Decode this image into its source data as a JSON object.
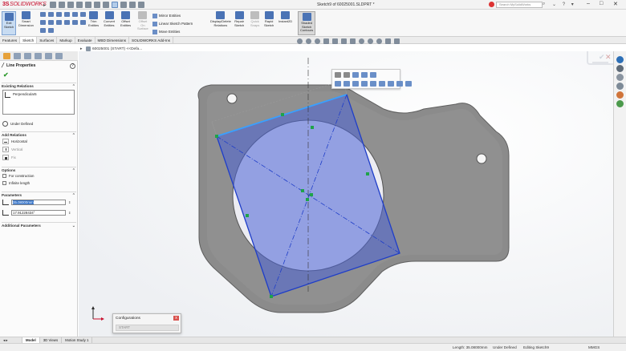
{
  "app": {
    "logo_ds": "3S",
    "logo_text": "SOLIDWORKS",
    "document_title": "Sketch9 of 60025001.SLDPRT *",
    "search_placeholder": "Search MySolidWorks",
    "minimize": "–",
    "restore": "□",
    "close": "✕"
  },
  "ribbon": {
    "exit_sketch": [
      "Exit",
      "Sketch"
    ],
    "smart_dimension": [
      "Smart",
      "Dimension"
    ],
    "trim_entities": [
      "Trim",
      "Entities"
    ],
    "convert_entities": [
      "Convert",
      "Entities"
    ],
    "offset_entities": [
      "Offset",
      "Entities"
    ],
    "offset_on_surface": [
      "Offset",
      "On",
      "Surface"
    ],
    "mirror_entities": "Mirror Entities",
    "linear_sketch_pattern": "Linear Sketch Pattern",
    "move_entities": "Move Entities",
    "display_delete_relations": [
      "Display/Delete",
      "Relations"
    ],
    "repair_sketch": [
      "Repair",
      "Sketch"
    ],
    "quick_snaps": [
      "Quick",
      "Snaps"
    ],
    "rapid_sketch": [
      "Rapid",
      "Sketch"
    ],
    "instant2d": "Instant2D",
    "shaded_sketch_contours": [
      "Shaded",
      "Sketch",
      "Contours"
    ]
  },
  "tabs": [
    "Features",
    "Sketch",
    "Surfaces",
    "Markup",
    "Evaluate",
    "MBD Dimensions",
    "SOLIDWORKS Add-Ins"
  ],
  "active_tab": "Sketch",
  "breadcrumb": "60025001 (START) <<Defa...",
  "panel": {
    "title": "Line Properties",
    "existing_relations": {
      "header": "Existing Relations",
      "items": [
        "Perpendicular5"
      ]
    },
    "status": "Under Defined",
    "add_relations": {
      "header": "Add Relations",
      "items": [
        "Horizontal",
        "Vertical",
        "Fix"
      ]
    },
    "options": {
      "header": "Options",
      "items": [
        "For construction",
        "Infinite length"
      ]
    },
    "parameters": {
      "header": "Parameters",
      "length": "35.08000mm",
      "angle": "17.91228434°"
    },
    "additional_parameters": "Additional Parameters"
  },
  "config_popup": {
    "title": "Configurations",
    "value": "START",
    "close": "x"
  },
  "bottom_tabs": [
    "Model",
    "3D Views",
    "Motion Study 1"
  ],
  "active_bottom_tab": "Model",
  "status": {
    "length": "Length: 35.08000mm",
    "definition": "Under Defined",
    "editing": "Editing Sketch9",
    "units": "MMGS"
  },
  "colors": {
    "part_fill": "#8b8b8b",
    "sketch_fill": "#5a73d8",
    "sketch_line": "#1f3ec8",
    "logo_red": "#c8102e"
  }
}
